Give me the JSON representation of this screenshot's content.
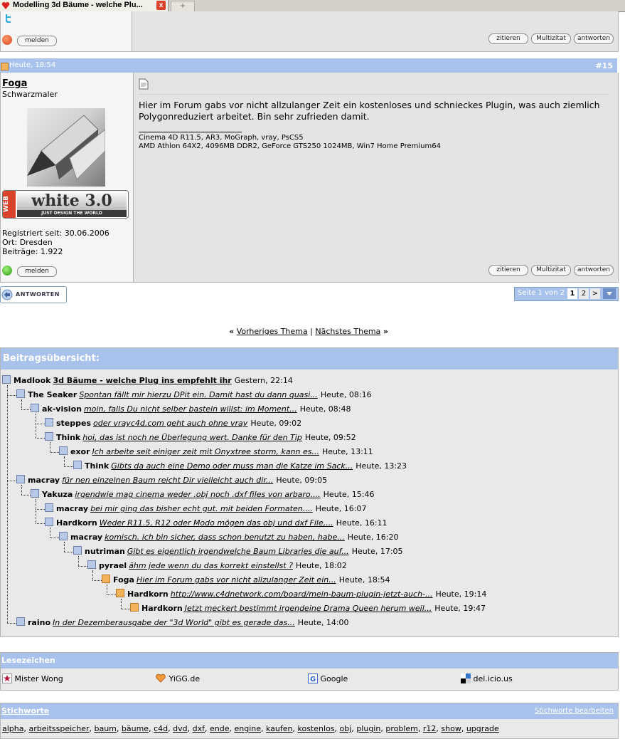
{
  "tab": {
    "title": "Modelling 3d Bäume - welche Plu...",
    "close": "x",
    "new": "+"
  },
  "prev_post": {
    "report": "melden",
    "quote": "zitieren",
    "multiquote": "Multizitat",
    "reply": "antworten"
  },
  "post": {
    "timestamp": "Heute, 18:54",
    "number": "#15",
    "author": "Foga",
    "rank": "Schwarzmaler",
    "badge_side": "WEB",
    "badge_main": "white 3.0",
    "badge_sub": "JUST DESIGN THE WORLD",
    "registered": "Registriert seit: 30.06.2006",
    "location": "Ort: Dresden",
    "posts": "Beiträge: 1.922",
    "text": "Hier im Forum gabs vor nicht allzulanger Zeit ein kostenloses und schnieckes Plugin, was auch ziemlich Polygonreduziert arbeitet. Bin sehr zufrieden damit.",
    "sig1": "Cinema 4D R11.5, AR3, MoGraph, vray, PsCS5",
    "sig2": "AMD Athlon 64X2, 4096MB DDR2, GeForce GTS250 1024MB, Win7 Home Premium64",
    "report": "melden",
    "quote": "zitieren",
    "multiquote": "Multizitat",
    "reply": "antworten"
  },
  "answer_button": "ANTWORTEN",
  "pager": {
    "label": "Seite 1 von 2",
    "p1": "1",
    "p2": "2",
    "next": ">"
  },
  "nav": {
    "prev": "Vorheriges Thema",
    "sep": "|",
    "next": "Nächstes Thema",
    "lq": "«",
    "rq": "»"
  },
  "tree": {
    "title": "Beitragsübersicht:",
    "rows": [
      {
        "user": "Madlook",
        "text": "3d Bäume - welche Plug ins empfehlt ihr",
        "time": "Gestern, 22:14",
        "depth": 0,
        "root": true,
        "new": false
      },
      {
        "user": "The Seaker",
        "text": "Spontan fällt mir hierzu DPit ein. Damit hast du dann quasi...",
        "time": "Heute, 08:16",
        "depth": 1,
        "new": false
      },
      {
        "user": "ak-vision",
        "text": "moin, falls Du nicht selber basteln willst: im Moment...",
        "time": "Heute, 08:48",
        "depth": 2,
        "new": false
      },
      {
        "user": "steppes",
        "text": "oder vrayc4d.com geht auch ohne vray",
        "time": "Heute, 09:02",
        "depth": 3,
        "new": false
      },
      {
        "user": "Think",
        "text": "hoi, das ist noch ne Überlegung wert. Danke für den Tip",
        "time": "Heute, 09:52",
        "depth": 3,
        "new": false
      },
      {
        "user": "exor",
        "text": "Ich arbeite seit einiger zeit mit Onyxtree storm, kann es...",
        "time": "Heute, 13:11",
        "depth": 4,
        "new": false
      },
      {
        "user": "Think",
        "text": "Gibts da auch eine Demo oder muss man die Katze im Sack...",
        "time": "Heute, 13:23",
        "depth": 5,
        "new": false
      },
      {
        "user": "macray",
        "text": "für nen einzelnen Baum reicht Dir vielleicht auch dir...",
        "time": "Heute, 09:05",
        "depth": 1,
        "new": false
      },
      {
        "user": "Yakuza",
        "text": "irgendwie mag cinema weder .obj noch .dxf files von arbaro....",
        "time": "Heute, 15:46",
        "depth": 2,
        "new": false
      },
      {
        "user": "macray",
        "text": "bei mir ging das bisher echt gut. mit beiden Formaten....",
        "time": "Heute, 16:07",
        "depth": 3,
        "new": false
      },
      {
        "user": "Hardkorn",
        "text": "Weder R11.5, R12 oder Modo mögen das obj und dxf File,...",
        "time": "Heute, 16:11",
        "depth": 3,
        "new": false
      },
      {
        "user": "macray",
        "text": "komisch. ich bin sicher, dass schon benutzt zu haben, habe...",
        "time": "Heute, 16:20",
        "depth": 4,
        "new": false
      },
      {
        "user": "nutriman",
        "text": "Gibt es eigentlich irgendwelche Baum Libraries die auf...",
        "time": "Heute, 17:05",
        "depth": 5,
        "new": false
      },
      {
        "user": "pyrael",
        "text": "ähm jede wenn du das korrekt einstellst ?",
        "time": "Heute, 18:02",
        "depth": 6,
        "new": false
      },
      {
        "user": "Foga",
        "text": "Hier im Forum gabs vor nicht allzulanger Zeit ein...",
        "time": "Heute, 18:54",
        "depth": 7,
        "new": true
      },
      {
        "user": "Hardkorn",
        "text": "http://www.c4dnetwork.com/board/mein-baum-plugin-jetzt-auch-...",
        "time": "Heute, 19:14",
        "depth": 8,
        "new": true
      },
      {
        "user": "Hardkorn",
        "text": "Jetzt meckert bestimmt irgendeine Drama Queen herum weil...",
        "time": "Heute, 19:47",
        "depth": 9,
        "new": true
      },
      {
        "user": "raino",
        "text": "In der Dezemberausgabe der \"3d World\" gibt es gerade das...",
        "time": "Heute, 14:00",
        "depth": 1,
        "new": false
      }
    ]
  },
  "bookmarks": {
    "title": "Lesezeichen",
    "items": [
      "Mister Wong",
      "YiGG.de",
      "Google",
      "del.icio.us"
    ]
  },
  "tags": {
    "title": "Stichworte",
    "edit": "Stichworte bearbeiten",
    "list": [
      "alpha",
      "arbeitsspeicher",
      "baum",
      "bäume",
      "c4d",
      "dvd",
      "dxf",
      "ende",
      "engine",
      "kaufen",
      "kostenlos",
      "obj",
      "plugin",
      "problem",
      "r12",
      "show",
      "upgrade"
    ]
  },
  "colors": {
    "header": "#a8c2ec",
    "panel": "#e4e4e4",
    "new_post_icon": "#f4b25a"
  }
}
